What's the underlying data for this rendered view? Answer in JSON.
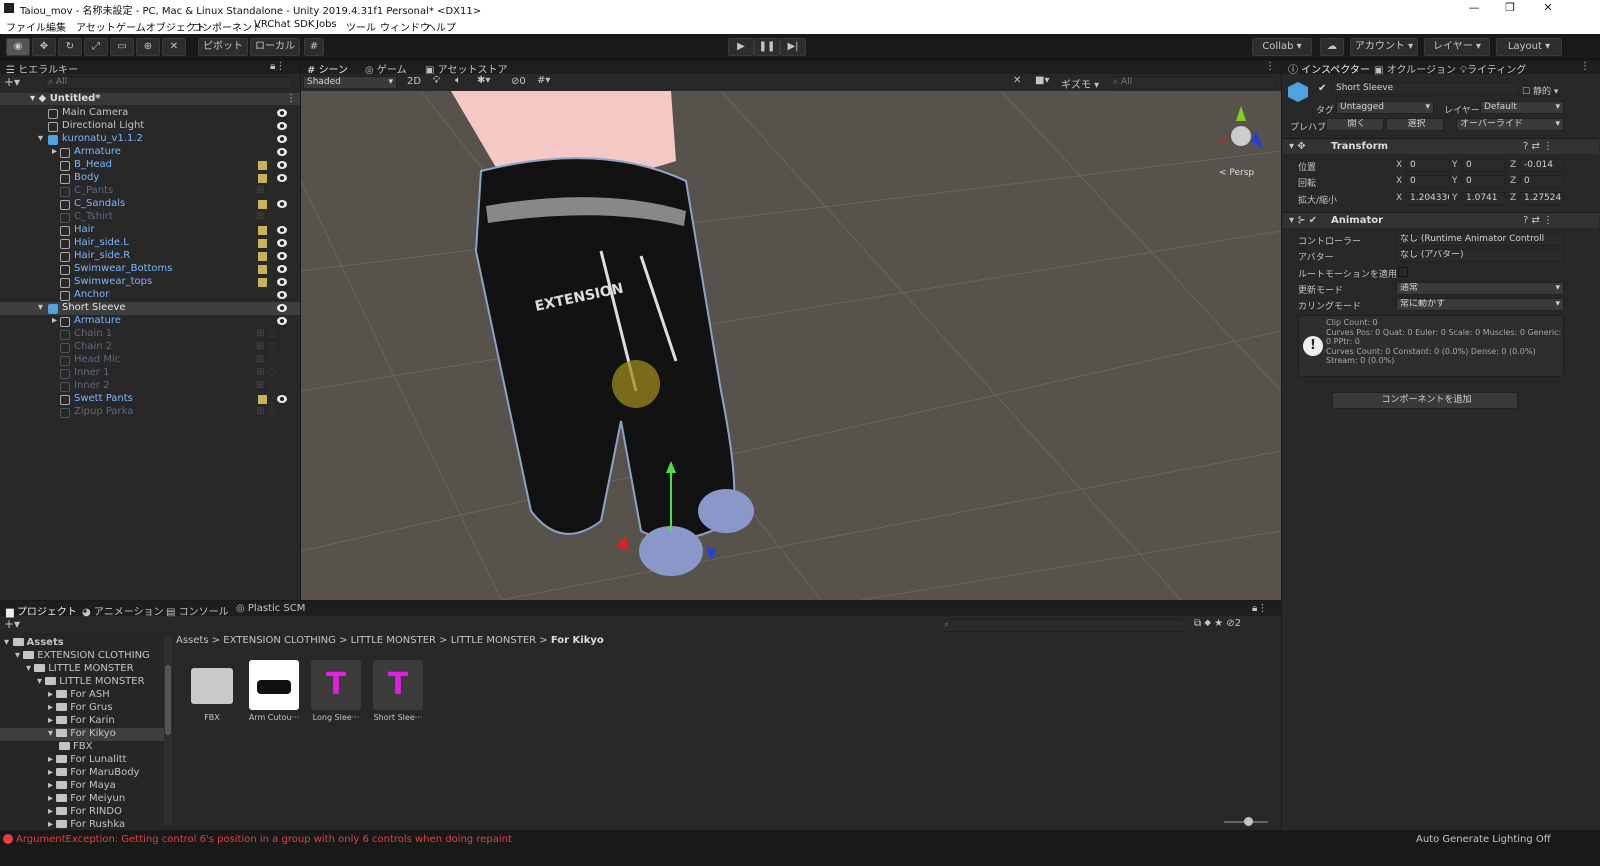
{
  "window": {
    "title": "Taiou_mov - 名称未設定 - PC, Mac & Linux Standalone - Unity 2019.4.31f1 Personal* <DX11>",
    "minimize": "—",
    "restore": "❐",
    "close": "✕"
  },
  "menu": [
    "ファイル",
    "編集",
    "アセット",
    "ゲームオブジェクト",
    "コンポーネント",
    "VRChat SDK",
    "Jobs",
    "ツール",
    "ウィンドウ",
    "ヘルプ"
  ],
  "toolbar": {
    "pivot": "ピボット",
    "local": "ローカル",
    "play": "▶",
    "pause": "❚❚",
    "step": "▶|",
    "collab": "Collab ▾",
    "account": "アカウント",
    "layers": "レイヤー",
    "layout": "Layout"
  },
  "hierarchy": {
    "tab": "ヒエラルキー",
    "search_placeholder": "All",
    "scene": "Untitled*",
    "rows": [
      {
        "label": "Main Camera",
        "indent": 1,
        "style": "normal",
        "eye": true,
        "grid": false
      },
      {
        "label": "Directional Light",
        "indent": 1,
        "style": "normal",
        "eye": true,
        "grid": false
      },
      {
        "label": "kuronatu_v1.1.2",
        "indent": 1,
        "style": "blue",
        "eye": true,
        "grid": false,
        "expanded": true
      },
      {
        "label": "Armature",
        "indent": 2,
        "style": "blue",
        "eye": true,
        "grid": false
      },
      {
        "label": "B_Head",
        "indent": 2,
        "style": "blue",
        "eye": true,
        "grid": true
      },
      {
        "label": "Body",
        "indent": 2,
        "style": "blue",
        "eye": true,
        "grid": true
      },
      {
        "label": "C_Pants",
        "indent": 2,
        "style": "dim",
        "eye": false,
        "grid": false
      },
      {
        "label": "C_Sandals",
        "indent": 2,
        "style": "blue",
        "eye": true,
        "grid": true
      },
      {
        "label": "C_Tshirt",
        "indent": 2,
        "style": "dim",
        "eye": false,
        "grid": false
      },
      {
        "label": "Hair",
        "indent": 2,
        "style": "blue",
        "eye": true,
        "grid": true
      },
      {
        "label": "Hair_side.L",
        "indent": 2,
        "style": "blue",
        "eye": true,
        "grid": true
      },
      {
        "label": "Hair_side.R",
        "indent": 2,
        "style": "blue",
        "eye": true,
        "grid": true
      },
      {
        "label": "Swimwear_Bottoms",
        "indent": 2,
        "style": "blue",
        "eye": true,
        "grid": true
      },
      {
        "label": "Swimwear_tops",
        "indent": 2,
        "style": "blue",
        "eye": true,
        "grid": true
      },
      {
        "label": "Anchor",
        "indent": 2,
        "style": "blue",
        "eye": true,
        "grid": false
      },
      {
        "label": "Short Sleeve",
        "indent": 1,
        "style": "normal",
        "eye": true,
        "grid": false,
        "selected": true
      },
      {
        "label": "Armature",
        "indent": 2,
        "style": "blue",
        "eye": true,
        "grid": false
      },
      {
        "label": "Chain 1",
        "indent": 2,
        "style": "dim",
        "eye": false,
        "grid": false
      },
      {
        "label": "Chain 2",
        "indent": 2,
        "style": "dim",
        "eye": false,
        "grid": false
      },
      {
        "label": "Head Mic",
        "indent": 2,
        "style": "dim",
        "eye": false,
        "grid": false
      },
      {
        "label": "Inner 1",
        "indent": 2,
        "style": "dim",
        "eye": false,
        "grid": false
      },
      {
        "label": "Inner 2",
        "indent": 2,
        "style": "dim",
        "eye": false,
        "grid": false
      },
      {
        "label": "Swett Pants",
        "indent": 2,
        "style": "blue",
        "eye": true,
        "grid": true
      },
      {
        "label": "Zipup Parka",
        "indent": 2,
        "style": "dim",
        "eye": false,
        "grid": false
      }
    ]
  },
  "scene": {
    "tabs": [
      "シーン",
      "ゲーム",
      "アセットストア"
    ],
    "shading": "Shaded",
    "mode2d": "2D",
    "gizmos": "ギズモ",
    "search_placeholder": "All",
    "persp": "< Persp",
    "layer_count": "0",
    "text_on_model": "EXTENSION"
  },
  "inspector": {
    "tabs": [
      "インスペクター",
      "オクルージョン",
      "ライティング"
    ],
    "object_name": "Short Sleeve",
    "static": "静的",
    "tag_label": "タグ",
    "tag": "Untagged",
    "layer_label": "レイヤー",
    "layer": "Default",
    "prefab_label": "プレハブ",
    "prefab_open": "開く",
    "prefab_select": "選択",
    "prefab_overrides": "オーバーライド",
    "transform": {
      "title": "Transform",
      "position_label": "位置",
      "rotation_label": "回転",
      "scale_label": "拡大/縮小",
      "position": [
        "0",
        "0",
        "-0.014"
      ],
      "rotation": [
        "0",
        "0",
        "0"
      ],
      "scale": [
        "1.204336",
        "1.0741",
        "1.27524"
      ]
    },
    "animator": {
      "title": "Animator",
      "controller_label": "コントローラー",
      "controller": "なし (Runtime Animator Controll",
      "avatar_label": "アバター",
      "avatar": "なし (アバター)",
      "root_motion_label": "ルートモーションを適用",
      "update_label": "更新モード",
      "update": "通常",
      "culling_label": "カリングモード",
      "culling": "常に動かす",
      "info": [
        "Clip Count: 0",
        "Curves Pos: 0 Quat: 0 Euler: 0 Scale: 0 Muscles: 0 Generic:",
        "0 PPtr: 0",
        "Curves Count: 0 Constant: 0 (0.0%) Dense: 0 (0.0%)",
        "Stream: 0 (0.0%)"
      ]
    },
    "add_component": "コンポーネントを追加"
  },
  "project": {
    "tabs": [
      "プロジェクト",
      "アニメーション",
      "コンソール",
      "Plastic SCM"
    ],
    "breadcrumb": [
      "Assets",
      "EXTENSION CLOTHING",
      "LITTLE MONSTER",
      "LITTLE MONSTER",
      "For Kikyo"
    ],
    "count": "2",
    "tree": [
      {
        "label": "Assets",
        "indent": 0,
        "bold": true
      },
      {
        "label": "EXTENSION CLOTHING",
        "indent": 1
      },
      {
        "label": "LITTLE MONSTER",
        "indent": 2
      },
      {
        "label": "LITTLE MONSTER",
        "indent": 3
      },
      {
        "label": "For ASH",
        "indent": 4
      },
      {
        "label": "For Grus",
        "indent": 4
      },
      {
        "label": "For Karin",
        "indent": 4
      },
      {
        "label": "For Kikyo",
        "indent": 4,
        "selected": true
      },
      {
        "label": "FBX",
        "indent": 5
      },
      {
        "label": "For Lunalitt",
        "indent": 4
      },
      {
        "label": "For MaruBody",
        "indent": 4
      },
      {
        "label": "For Maya",
        "indent": 4
      },
      {
        "label": "For Meiyun",
        "indent": 4
      },
      {
        "label": "For RINDO",
        "indent": 4
      },
      {
        "label": "For Rushka",
        "indent": 4
      }
    ],
    "assets": [
      {
        "name": "FBX",
        "kind": "folder"
      },
      {
        "name": "Arm Cutou···",
        "kind": "texture"
      },
      {
        "name": "Long Slee···",
        "kind": "material"
      },
      {
        "name": "Short Slee···",
        "kind": "material"
      }
    ]
  },
  "status": {
    "error": "ArgumentException: Getting control 6's position in a group with only 6 controls when doing repaint",
    "lighting": "Auto Generate Lighting Off"
  },
  "colors": {
    "accent_blue": "#7cb6ff",
    "error_red": "#e04040",
    "selection": "#2c5d87"
  }
}
